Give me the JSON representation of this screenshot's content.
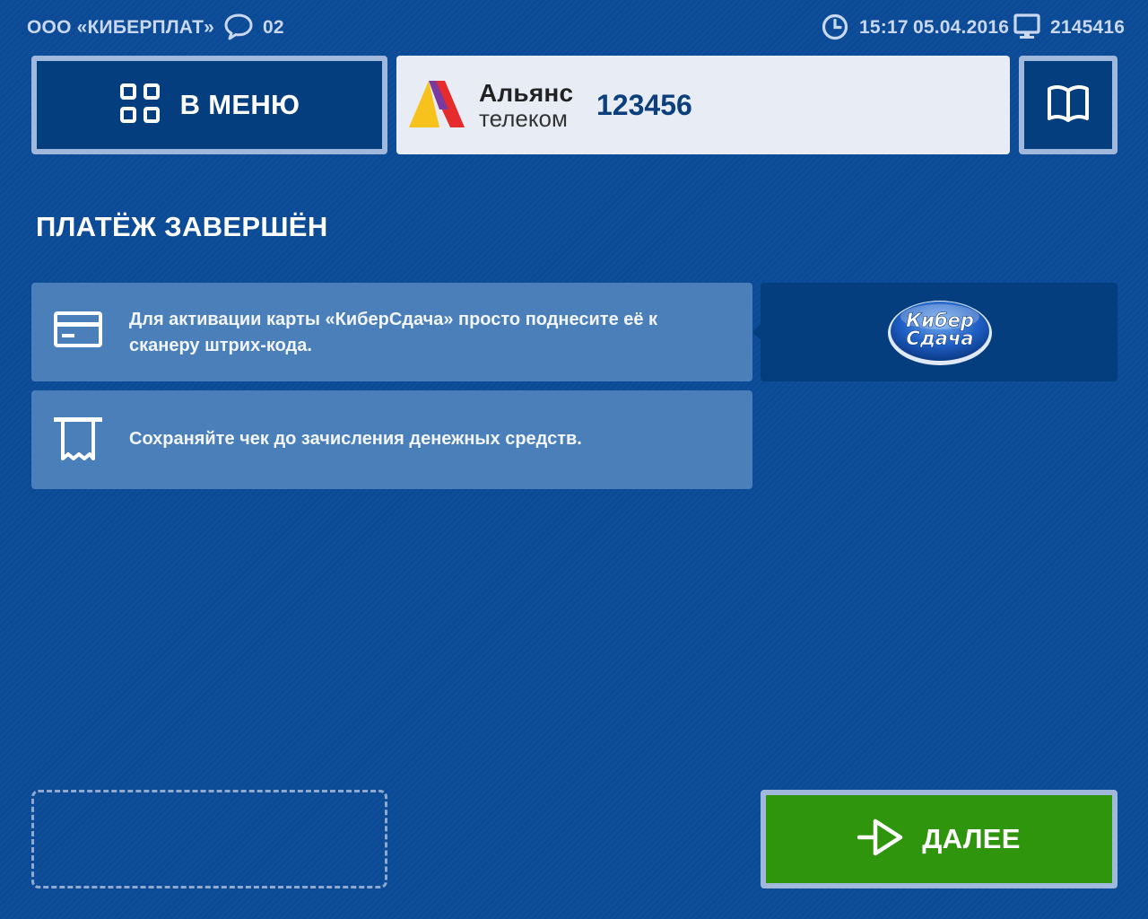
{
  "header": {
    "company": "ООО «КИБЕРПЛАТ»",
    "messages_count": "02",
    "time": "15:17",
    "date": "05.04.2016",
    "terminal_id": "2145416",
    "icons": [
      "chat-bubble-icon",
      "clock-icon",
      "monitor-icon"
    ]
  },
  "menu_button": {
    "label": "В МЕНЮ",
    "icon": "grid-icon"
  },
  "provider": {
    "name_line1": "Альянс",
    "name_line2": "телеком",
    "account": "123456",
    "logo_colors": [
      "#f7c21b",
      "#e52b2b",
      "#7b3aa0"
    ]
  },
  "book_button": {
    "icon": "book-icon"
  },
  "page_title": "ПЛАТЁЖ ЗАВЕРШЁН",
  "notices": [
    {
      "icon": "card-icon",
      "text": "Для активации карты «КиберСдача»  просто поднесите её к сканеру штрих-кода."
    },
    {
      "icon": "receipt-icon",
      "text": "Сохраняйте чек до зачисления денежных средств."
    }
  ],
  "promo": {
    "logo_line1": "Кибер",
    "logo_line2": "Сдача"
  },
  "next_button": {
    "label": "ДАЛЕЕ",
    "icon": "arrow-right-icon"
  },
  "colors": {
    "background": "#0b4a96",
    "panel_dark": "#053e7f",
    "notice_box": "#4a7fba",
    "button_border": "#9fb8db",
    "next_button": "#2f950d"
  }
}
